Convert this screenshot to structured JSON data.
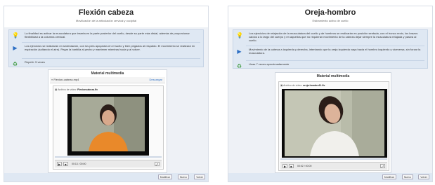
{
  "left": {
    "title": "Flexión cabeza",
    "subtitle": "Movilización de la articulación cervical y occipital",
    "info": [
      {
        "icon": "lightbulb-icon",
        "text": "La finalidad es activar la musculatura que inserta en la parte posterior del cuello, desde su parte más distal, además de proporcionar flexibilidad a la columna cervical."
      },
      {
        "icon": "play-icon",
        "text": "Los ejercicios se realizarán en sedestación, con los pies apoyados en el suelo y bien pegados al respaldo. El movimiento se realizará en espiración (soltando el aire). Pegar la barbilla al pecho y mantener mientras hacia y al volver."
      },
      {
        "icon": "repeat-icon",
        "text": "Repetir: 5 veces"
      }
    ],
    "media": {
      "title": "Material multimedia",
      "back_label": "« Flexion-cabeza.mp4",
      "download_label": "Descargar",
      "file_label": "Archivo de vídeo:",
      "file_name": "Flexioncabeza.flv",
      "time": "00:13 / 00:00",
      "progress": 0.0
    },
    "footer": [
      "Modificar",
      "Nuevo",
      "Volver"
    ]
  },
  "right": {
    "title": "Oreja-hombro",
    "subtitle": "Estiramiento activo de cuello",
    "info": [
      {
        "icon": "lightbulb-icon",
        "text": "Los ejercicios de relajación de la musculatura del cuello y de hombros se realizarán en posición sentada, con el tronco recto, los brazos caídos a lo largo del cuerpo y en aquellos que no requieran movimiento de la cabeza dejar siempre la musculatura relajada y pasiva al cuello."
      },
      {
        "icon": "play-icon",
        "text": "Movimiento de la cabeza a izquierda y derecha, intentando que la oreja izquierda vaya hacia el hombro izquierdo y viceversa, sin forzar la musculatura."
      },
      {
        "icon": "repeat-icon",
        "text": "Unas 7 veces aproximadamente"
      }
    ],
    "media": {
      "title": "Material multimedia",
      "file_label": "Archivo de vídeo:",
      "file_name": "oreja-hombro11.flv",
      "time": "00:02 / 00:00",
      "progress": 0.0
    },
    "footer": [
      "Modificar",
      "Nuevo",
      "Volver"
    ]
  },
  "icons": {
    "lightbulb": "💡",
    "play": "▶",
    "repeat": "♻"
  }
}
